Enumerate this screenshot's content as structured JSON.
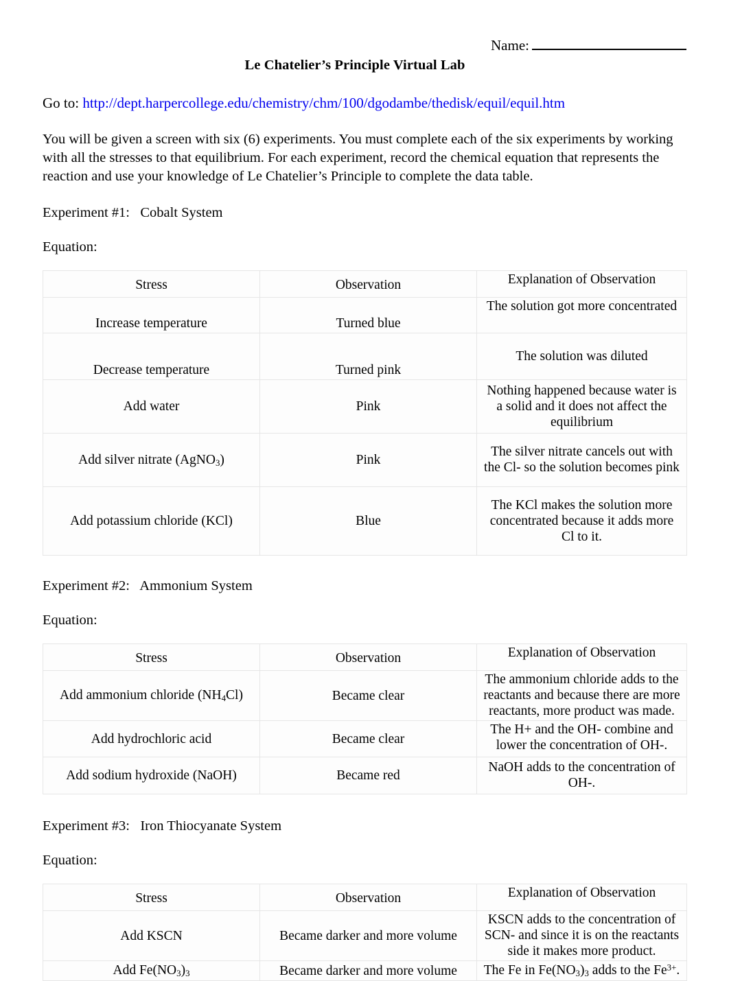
{
  "header": {
    "name_label": "Name:",
    "title": "Le Chatelier’s Principle Virtual Lab",
    "goto_label": "Go to: ",
    "url": "http://dept.harpercollege.edu/chemistry/chm/100/dgodambe/thedisk/equil/equil.htm",
    "url_color": "#0000ee"
  },
  "intro": "You will be given a screen with six (6) experiments. You must complete each of the six experiments by working with all the stresses to that equilibrium.  For each experiment, record the chemical equation that represents the reaction and use your knowledge of Le Chatelier’s Principle to complete the data table.",
  "columns": {
    "stress": "Stress",
    "observation": "Observation",
    "explanation": "Explanation of Observation"
  },
  "equation_label": "Equation:",
  "experiments": [
    {
      "heading": "Experiment #1:   Cobalt System",
      "rows": [
        {
          "stress": "Increase temperature",
          "stress_html": "Increase temperature",
          "observation": "Turned blue",
          "explanation": "The solution got more concentrated"
        },
        {
          "stress": "Decrease temperature",
          "stress_html": "Decrease temperature",
          "observation": "Turned pink",
          "explanation": "The solution was diluted"
        },
        {
          "stress": "Add water",
          "stress_html": "Add water",
          "observation": "Pink",
          "explanation": "Nothing happened because water is a solid and it does not affect the equilibrium"
        },
        {
          "stress": "Add silver nitrate (AgNO3)",
          "stress_html": "Add silver nitrate (AgNO<sub>3</sub>)",
          "observation": "Pink",
          "explanation": "The silver nitrate cancels out with the Cl- so the solution becomes pink"
        },
        {
          "stress": "Add potassium chloride (KCl)",
          "stress_html": "Add potassium chloride (KCl)",
          "observation": "Blue",
          "explanation": "The KCl makes the solution more concentrated because it adds more Cl to it."
        }
      ]
    },
    {
      "heading": "Experiment #2:   Ammonium System",
      "rows": [
        {
          "stress": "Add ammonium chloride (NH4Cl)",
          "stress_html": "Add ammonium chloride (NH<sub>4</sub>Cl)",
          "observation": "Became clear",
          "explanation": "The ammonium chloride adds to the reactants and because there are more reactants, more product was made."
        },
        {
          "stress": "Add hydrochloric acid",
          "stress_html": "Add hydrochloric acid",
          "observation": "Became clear",
          "explanation": "The H+ and the OH- combine and lower the concentration of OH-."
        },
        {
          "stress": "Add sodium hydroxide (NaOH)",
          "stress_html": "Add sodium hydroxide (NaOH)",
          "observation": "Became red",
          "explanation": "NaOH adds to the concentration of OH-."
        }
      ]
    },
    {
      "heading": "Experiment #3:   Iron Thiocyanate System",
      "rows": [
        {
          "stress": "Add KSCN",
          "stress_html": "Add KSCN",
          "observation": "Became darker and more volume",
          "explanation": "KSCN adds to the concentration of SCN- and since it is on the reactants side it makes more product."
        },
        {
          "stress": "Add Fe(NO3)3",
          "stress_html": "Add Fe(NO<sub>3</sub>)<sub>3</sub>",
          "observation": "Became darker and more volume",
          "explanation": "The Fe in Fe(NO3)3 adds to the Fe3+.",
          "explanation_html": "The Fe in Fe(NO<sub>3</sub>)<sub>3</sub> adds to the Fe<sup>3+</sup>."
        }
      ]
    }
  ]
}
